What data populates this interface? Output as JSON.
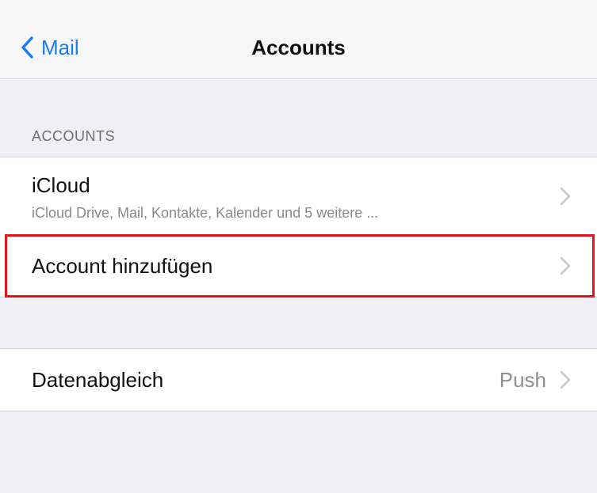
{
  "navbar": {
    "back_label": "Mail",
    "title": "Accounts"
  },
  "accounts_section": {
    "header": "ACCOUNTS",
    "rows": [
      {
        "title": "iCloud",
        "subtitle": "iCloud Drive, Mail, Kontakte, Kalender und 5 weitere ..."
      },
      {
        "title": "Account hinzufügen"
      }
    ]
  },
  "sync_section": {
    "rows": [
      {
        "title": "Datenabgleich",
        "value": "Push"
      }
    ]
  },
  "colors": {
    "accent": "#1a7cf5",
    "highlight": "#e0141a",
    "background": "#efeff4"
  },
  "icons": {
    "back": "chevron-left-icon",
    "disclosure": "chevron-right-icon"
  }
}
